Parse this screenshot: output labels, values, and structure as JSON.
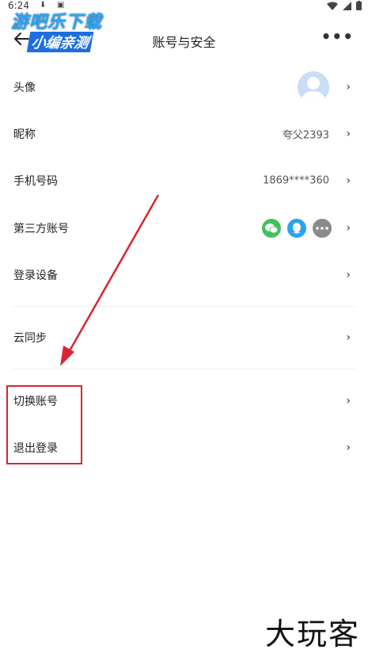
{
  "status_bar": {
    "time": "6:24"
  },
  "watermark": {
    "line1": "游吧乐下载",
    "line2": "小编亲测",
    "bottom": "大玩客"
  },
  "header": {
    "title": "账号与安全",
    "more": "•••"
  },
  "rows": {
    "avatar": {
      "label": "头像"
    },
    "nickname": {
      "label": "昵称",
      "value": "夸父2393"
    },
    "phone": {
      "label": "手机号码",
      "value": "1869****360"
    },
    "third_party": {
      "label": "第三方账号"
    },
    "devices": {
      "label": "登录设备"
    },
    "cloud_sync": {
      "label": "云同步"
    },
    "switch_account": {
      "label": "切换账号"
    },
    "logout": {
      "label": "退出登录"
    }
  },
  "colors": {
    "wechat": "#41c15b",
    "qq": "#2aa3f0",
    "more": "#8a8a8a",
    "highlight": "#d7262f"
  },
  "icons": {
    "back": "arrow-left-icon",
    "more": "more-dots-icon",
    "chevron": "chevron-right-icon",
    "wechat": "wechat-icon",
    "qq": "qq-icon",
    "more_social": "more-dots-icon"
  }
}
